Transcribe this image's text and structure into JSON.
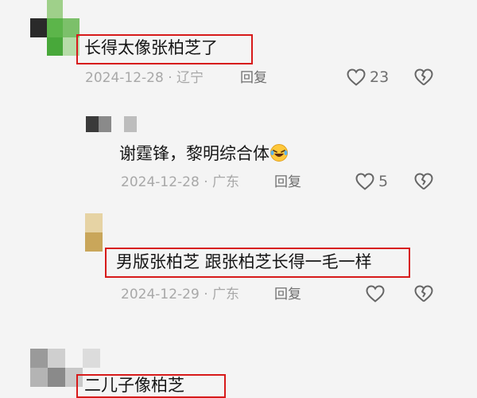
{
  "comments": [
    {
      "text": "长得太像张柏芝了",
      "date": "2024-12-28",
      "location": "辽宁",
      "reply_label": "回复",
      "likes": "23"
    },
    {
      "text": "谢霆锋，黎明综合体",
      "emoji": "laughing-crying-emoji",
      "date": "2024-12-28",
      "location": "广东",
      "reply_label": "回复",
      "likes": "5"
    },
    {
      "text": "男版张柏芝  跟张柏芝长得一毛一样",
      "date": "2024-12-29",
      "location": "广东",
      "reply_label": "回复",
      "likes": ""
    },
    {
      "text": "二儿子像柏芝"
    }
  ],
  "separator": "·",
  "colors": {
    "highlight_box": "#d71a1a",
    "text": "#161616",
    "meta": "#a8a8a8"
  }
}
